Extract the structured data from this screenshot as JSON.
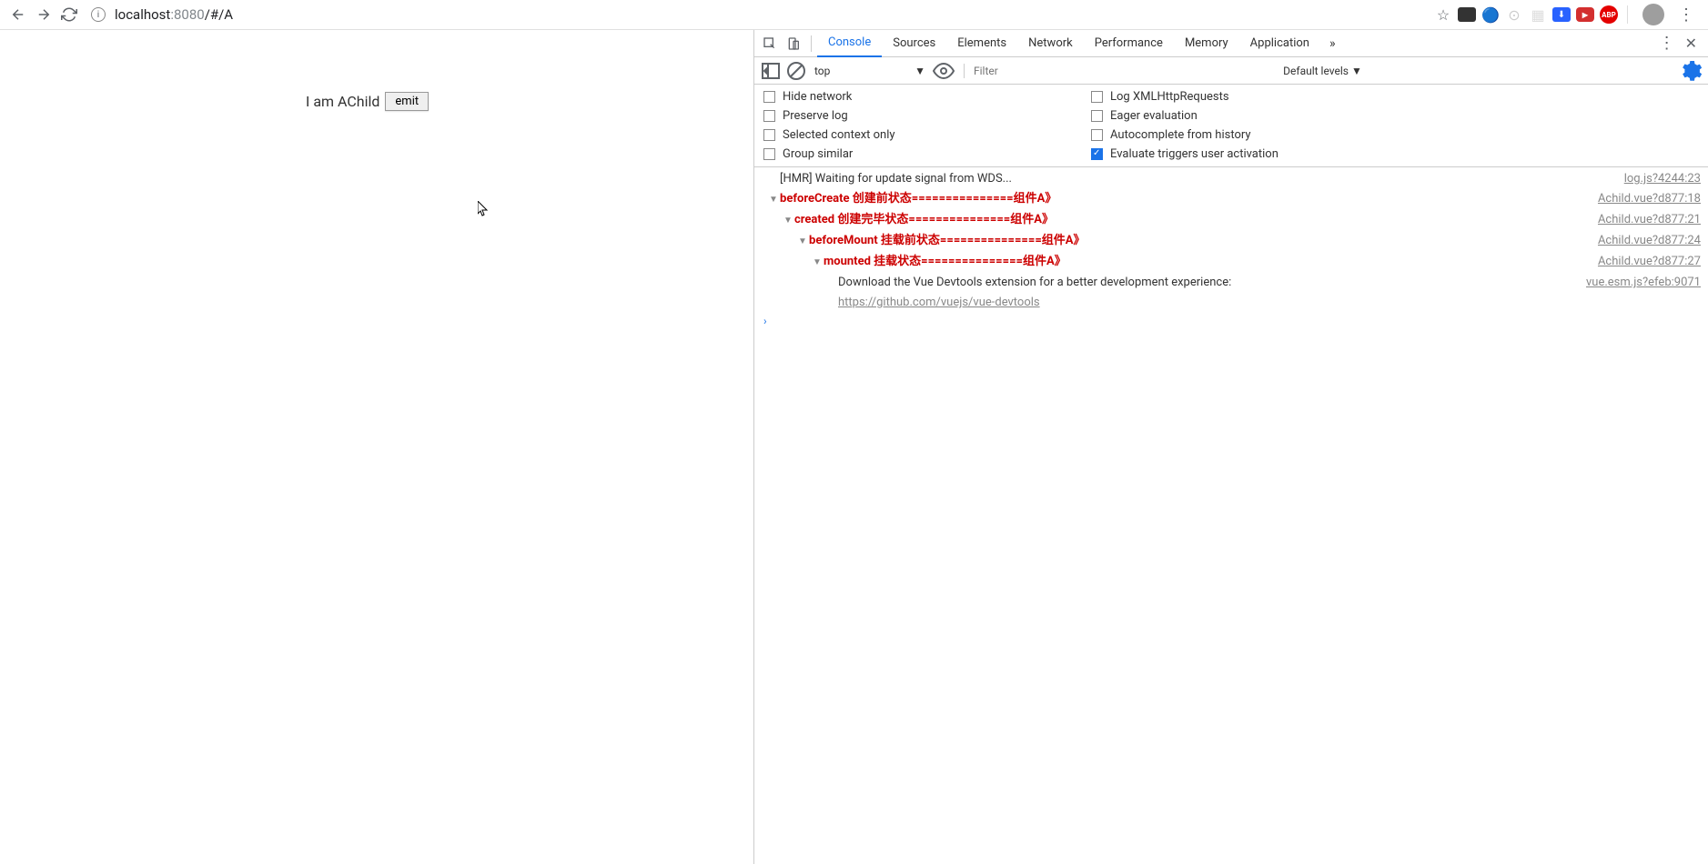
{
  "browser": {
    "url_host": "localhost",
    "url_port": ":8080",
    "url_path": "/#/A"
  },
  "page": {
    "heading": "I am AChild",
    "button": "emit"
  },
  "devtools": {
    "tabs": [
      "Console",
      "Sources",
      "Elements",
      "Network",
      "Performance",
      "Memory",
      "Application"
    ],
    "active_tab": "Console",
    "context_select": "top",
    "filter_placeholder": "Filter",
    "levels": "Default levels ▼",
    "settings": {
      "hide_network": "Hide network",
      "log_xhr": "Log XMLHttpRequests",
      "preserve_log": "Preserve log",
      "eager_eval": "Eager evaluation",
      "selected_context": "Selected context only",
      "autocomplete_history": "Autocomplete from history",
      "group_similar": "Group similar",
      "eval_triggers": "Evaluate triggers user activation"
    },
    "logs": [
      {
        "indent": 0,
        "toggle": false,
        "style": "plain",
        "text": "[HMR] Waiting for update signal from WDS...",
        "link": "log.js?4244:23"
      },
      {
        "indent": 0,
        "toggle": true,
        "style": "red",
        "text": "beforeCreate 创建前状态===============组件A》",
        "link": "Achild.vue?d877:18"
      },
      {
        "indent": 1,
        "toggle": true,
        "style": "red",
        "text": "created 创建完毕状态===============组件A》",
        "link": "Achild.vue?d877:21"
      },
      {
        "indent": 2,
        "toggle": true,
        "style": "red",
        "text": "beforeMount 挂载前状态===============组件A》",
        "link": "Achild.vue?d877:24"
      },
      {
        "indent": 3,
        "toggle": true,
        "style": "red",
        "text": "mounted 挂载状态===============组件A》",
        "link": "Achild.vue?d877:27"
      },
      {
        "indent": 4,
        "toggle": false,
        "style": "plain",
        "text": "Download the Vue Devtools extension for a better development experience:",
        "link": "vue.esm.js?efeb:9071"
      },
      {
        "indent": 4,
        "toggle": false,
        "style": "url",
        "text": "https://github.com/vuejs/vue-devtools",
        "link": ""
      }
    ]
  }
}
